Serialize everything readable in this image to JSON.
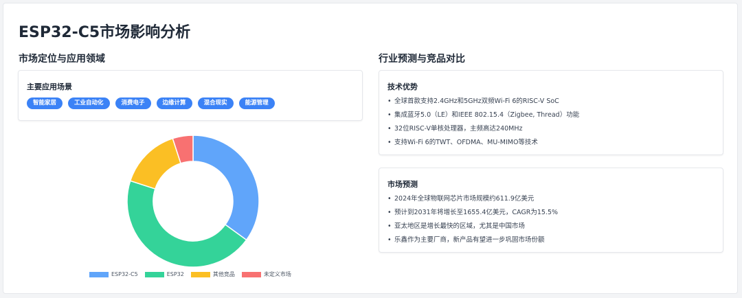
{
  "page": {
    "title": "ESP32-C5市场影响分析"
  },
  "left": {
    "section_title": "市场定位与应用领域",
    "scenes_card": {
      "title": "主要应用场景",
      "tags": [
        "智能家居",
        "工业自动化",
        "消费电子",
        "边缘计算",
        "混合现实",
        "能源管理"
      ]
    }
  },
  "right": {
    "section_title": "行业预测与竞品对比",
    "advantages_card": {
      "title": "技术优势",
      "bullet": "•",
      "items": [
        "全球首款支持2.4GHz和5GHz双频Wi-Fi 6的RISC-V SoC",
        "集成蓝牙5.0（LE）和IEEE 802.15.4（Zigbee, Thread）功能",
        "32位RISC-V单核处理器，主频高达240MHz",
        "支持Wi-Fi 6的TWT、OFDMA、MU-MIMO等技术"
      ]
    },
    "forecast_card": {
      "title": "市场预测",
      "bullet": "•",
      "items": [
        "2024年全球物联网芯片市场规模约611.9亿美元",
        "预计到2031年将增长至1655.4亿美元，CAGR为15.5%",
        "亚太地区是增长最快的区域，尤其是中国市场",
        "乐鑫作为主要厂商，新产品有望进一步巩固市场份额"
      ]
    }
  },
  "chart_data": {
    "type": "pie",
    "variant": "doughnut",
    "title": "",
    "categories": [
      "ESP32-C5",
      "ESP32",
      "其他竞品",
      "未定义市场"
    ],
    "values": [
      35,
      45,
      15,
      5
    ],
    "colors": [
      "#60a5fa",
      "#34d399",
      "#fbbf24",
      "#f87171"
    ],
    "legend_position": "bottom"
  }
}
